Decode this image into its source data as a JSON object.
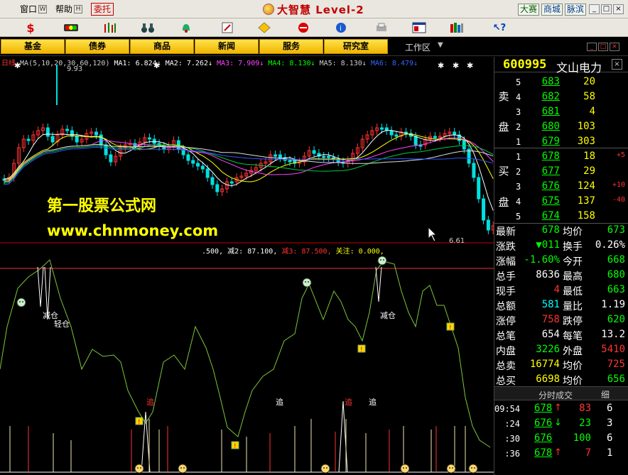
{
  "menu": {
    "items": [
      {
        "label": "窗口",
        "key": "W"
      },
      {
        "label": "帮助",
        "key": "H"
      }
    ],
    "entrust": "委托",
    "brand": "大智慧 Level-2",
    "right_buttons": [
      "大赛",
      "商城",
      "脉滨"
    ],
    "window_controls": [
      "_",
      "□",
      "×"
    ]
  },
  "toolbar": {
    "icons": [
      "dollar-icon",
      "traffic-light-icon",
      "bar-icon",
      "binoculars-icon",
      "bell-icon",
      "flag-icon",
      "diamond-icon",
      "stop-icon",
      "info-icon",
      "print-icon",
      "window-icon",
      "columns-icon",
      "help-icon"
    ]
  },
  "nav": {
    "buttons": [
      "基金",
      "债券",
      "商品",
      "新闻",
      "服务",
      "研究室"
    ],
    "workarea": "工作区"
  },
  "chart": {
    "period": "日线",
    "ma_legend": [
      {
        "text": "MA(5,10,20,30,60,120)",
        "color": "#cccccc"
      },
      {
        "text": "MA1: 6.824↓",
        "color": "#ffffff"
      },
      {
        "text": "MA2: 7.262↓",
        "color": "#ffffff"
      },
      {
        "text": "MA3: 7.909↓",
        "color": "#ff44ff"
      },
      {
        "text": "MA4: 8.130↓",
        "color": "#00ff00"
      },
      {
        "text": "MA5: 8.130↓",
        "color": "#cccccc"
      },
      {
        "text": "MA6: 8.479↓",
        "color": "#3366ff"
      }
    ],
    "high_label": "9.93",
    "low_label": "6.61",
    "indicator_legend": [
      {
        "text": ".500,",
        "color": "#ffffff"
      },
      {
        "text": "减2: 87.100,",
        "color": "#ffffff"
      },
      {
        "text": "减3: 87.500,",
        "color": "#ff3333"
      },
      {
        "text": "关注: 0.000,",
        "color": "#ffff00"
      }
    ],
    "signals": {
      "reduce": "减仓",
      "light": "轻仓",
      "chase": "追"
    },
    "colors": {
      "up": "#ff3232",
      "down": "#00e0e0",
      "ind": "#7cc63a"
    }
  },
  "watermark": {
    "line1": "第一股票公式网",
    "line2": "www.chnmoney.com"
  },
  "quote": {
    "code": "600995",
    "name": "文山电力",
    "sell_label": [
      "卖",
      "盘"
    ],
    "buy_label": [
      "买",
      "盘"
    ],
    "sells": [
      {
        "level": "5",
        "price": "683",
        "vol": "20"
      },
      {
        "level": "4",
        "price": "682",
        "vol": "58"
      },
      {
        "level": "3",
        "price": "681",
        "vol": "4"
      },
      {
        "level": "2",
        "price": "680",
        "vol": "103"
      },
      {
        "level": "1",
        "price": "679",
        "vol": "303"
      }
    ],
    "buys": [
      {
        "level": "1",
        "price": "678",
        "vol": "18",
        "chg": "+5"
      },
      {
        "level": "2",
        "price": "677",
        "vol": "29",
        "chg": ""
      },
      {
        "level": "3",
        "price": "676",
        "vol": "124",
        "chg": "+10"
      },
      {
        "level": "4",
        "price": "675",
        "vol": "137",
        "chg": "-40"
      },
      {
        "level": "5",
        "price": "674",
        "vol": "158",
        "chg": ""
      }
    ],
    "stats": [
      {
        "l1": "最新",
        "v1": "678",
        "c1": "#00ff00",
        "l2": "均价",
        "v2": "673",
        "c2": "#00ff00"
      },
      {
        "l1": "涨跌",
        "v1": "▼011",
        "c1": "#00ff00",
        "l2": "换手",
        "v2": "0.26%",
        "c2": "#ffffff"
      },
      {
        "l1": "涨幅",
        "v1": "-1.60%",
        "c1": "#00ff00",
        "l2": "今开",
        "v2": "668",
        "c2": "#00ff00"
      },
      {
        "l1": "总手",
        "v1": "8636",
        "c1": "#ffffff",
        "l2": "最高",
        "v2": "680",
        "c2": "#00ff00"
      },
      {
        "l1": "现手",
        "v1": "4",
        "c1": "#ff3333",
        "l2": "最低",
        "v2": "663",
        "c2": "#00ff00"
      },
      {
        "l1": "总额",
        "v1": "581",
        "c1": "#00ffff",
        "l2": "量比",
        "v2": "1.19",
        "c2": "#ffffff"
      },
      {
        "l1": "涨停",
        "v1": "758",
        "c1": "#ff3333",
        "l2": "跌停",
        "v2": "620",
        "c2": "#00ff00"
      },
      {
        "l1": "总笔",
        "v1": "654",
        "c1": "#ffffff",
        "l2": "每笔",
        "v2": "13.2",
        "c2": "#ffffff"
      },
      {
        "l1": "内盘",
        "v1": "3226",
        "c1": "#00ff00",
        "l2": "外盘",
        "v2": "5410",
        "c2": "#ff3333"
      },
      {
        "l1": "总卖",
        "v1": "16774",
        "c1": "#ffff00",
        "l2": "均价",
        "v2": "725",
        "c2": "#ff3333"
      },
      {
        "l1": "总买",
        "v1": "6698",
        "c1": "#ffff00",
        "l2": "均价",
        "v2": "656",
        "c2": "#00ff00"
      }
    ],
    "ticks_header": "分时成交",
    "ticks_detail": "细",
    "ticks": [
      {
        "time": "09:54",
        "price": "678",
        "arrow": "↑",
        "vol": "83",
        "vcolor": "#ff3333",
        "n": "6"
      },
      {
        "time": ":24",
        "price": "676",
        "arrow": "↓",
        "vol": "23",
        "vcolor": "#00ff00",
        "n": "3"
      },
      {
        "time": ":30",
        "price": "676",
        "arrow": "",
        "vol": "100",
        "vcolor": "#00ff00",
        "n": "6"
      },
      {
        "time": ":36",
        "price": "678",
        "arrow": "↑",
        "vol": "7",
        "vcolor": "#ff3333",
        "n": "1"
      }
    ]
  }
}
